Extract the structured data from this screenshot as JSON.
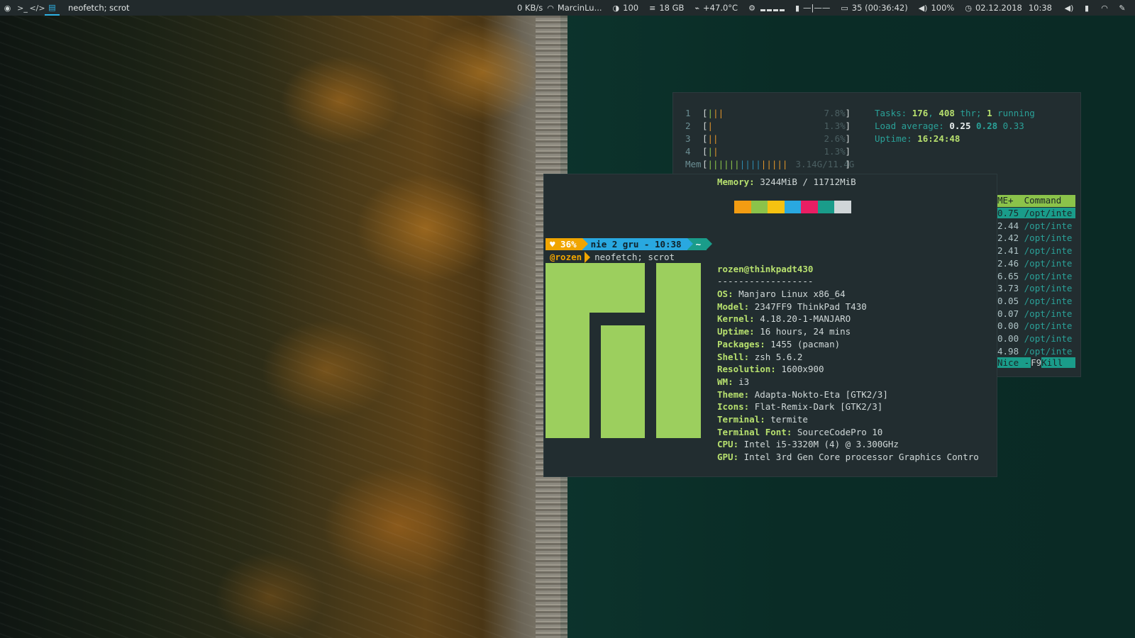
{
  "topbar": {
    "workspaces": [
      {
        "icon": "chrome-icon",
        "glyph": "◉"
      },
      {
        "icon": "terminal-icon",
        "glyph": ">_"
      },
      {
        "icon": "code-icon",
        "glyph": "</>"
      },
      {
        "icon": "document-icon",
        "glyph": "▤"
      }
    ],
    "window_title": "neofetch; scrot",
    "net_speed": "0 KB/s",
    "wifi_name": "MarcinLu...",
    "brightness": "100",
    "disk": "18 GB",
    "temperature": "+47.0°C",
    "cpu_bars": [
      0.25,
      0.25,
      0.25,
      0.25
    ],
    "volume_bar_glyph": "—|——",
    "battery": "35 (00:36:42)",
    "volume": "100%",
    "date": "02.12.2018",
    "time": "10:38",
    "accent": "#2eb3e5"
  },
  "htop": {
    "cpus": [
      {
        "num": "1",
        "bars": [
          {
            "c": "g",
            "n": 1
          },
          {
            "c": "o",
            "n": 2
          }
        ],
        "pct": "7.8%"
      },
      {
        "num": "2",
        "bars": [
          {
            "c": "o",
            "n": 1
          }
        ],
        "pct": "1.3%"
      },
      {
        "num": "3",
        "bars": [
          {
            "c": "o",
            "n": 2
          }
        ],
        "pct": "2.6%"
      },
      {
        "num": "4",
        "bars": [
          {
            "c": "g",
            "n": 1
          },
          {
            "c": "o",
            "n": 1
          }
        ],
        "pct": "1.3%"
      }
    ],
    "mem": {
      "label": "Mem",
      "bars": [
        {
          "c": "g",
          "n": 6
        },
        {
          "c": "b",
          "n": 4
        },
        {
          "c": "o",
          "n": 5
        }
      ],
      "value": "3.14G/11.4G"
    },
    "tasks_label": "Tasks:",
    "tasks": "176",
    "thr": "408",
    "thr_label": "thr;",
    "running": "1",
    "running_label": "running",
    "load_label": "Load average:",
    "load1": "0.25",
    "load5": "0.28",
    "load15": "0.33",
    "uptime_label": "Uptime:",
    "uptime": "16:24:48",
    "proc_header": "ME+  Command",
    "procs": [
      {
        "time": "0.75",
        "cmd": "/opt/inte"
      },
      {
        "time": "2.44",
        "cmd": "/opt/inte"
      },
      {
        "time": "2.42",
        "cmd": "/opt/inte"
      },
      {
        "time": "2.41",
        "cmd": "/opt/inte"
      },
      {
        "time": "2.46",
        "cmd": "/opt/inte"
      },
      {
        "time": "6.65",
        "cmd": "/opt/inte"
      },
      {
        "time": "3.73",
        "cmd": "/opt/inte"
      },
      {
        "time": "0.05",
        "cmd": "/opt/inte"
      },
      {
        "time": "0.07",
        "cmd": "/opt/inte"
      },
      {
        "time": "0.00",
        "cmd": "/opt/inte"
      },
      {
        "time": "0.00",
        "cmd": "/opt/inte"
      },
      {
        "time": "4.98",
        "cmd": "/opt/inte"
      }
    ],
    "footer_nice": "Nice -",
    "footer_key": "F9",
    "footer_kill": "Kill"
  },
  "terminal": {
    "memory_label": "Memory",
    "memory_value": "3244MiB / 11712MiB",
    "palette": [
      "#f39c12",
      "#8bc34a",
      "#f5c211",
      "#29a8e0",
      "#e91e63",
      "#1a9c8a",
      "#d0d6d8"
    ],
    "prompt": {
      "battery": "♥ 36%",
      "date": "nie  2 gru - 10:38",
      "dir": "~",
      "user": "@rozen",
      "command": "neofetch; scrot"
    },
    "info_title": "rozen@thinkpadt430",
    "separator": "------------------",
    "info": [
      {
        "label": "OS",
        "value": "Manjaro Linux x86_64"
      },
      {
        "label": "Model",
        "value": "2347FF9 ThinkPad T430"
      },
      {
        "label": "Kernel",
        "value": "4.18.20-1-MANJARO"
      },
      {
        "label": "Uptime",
        "value": "16 hours, 24 mins"
      },
      {
        "label": "Packages",
        "value": "1455 (pacman)"
      },
      {
        "label": "Shell",
        "value": "zsh 5.6.2"
      },
      {
        "label": "Resolution",
        "value": "1600x900"
      },
      {
        "label": "WM",
        "value": "i3"
      },
      {
        "label": "Theme",
        "value": "Adapta-Nokto-Eta [GTK2/3]"
      },
      {
        "label": "Icons",
        "value": "Flat-Remix-Dark [GTK2/3]"
      },
      {
        "label": "Terminal",
        "value": "termite"
      },
      {
        "label": "Terminal Font",
        "value": "SourceCodePro 10"
      },
      {
        "label": "CPU",
        "value": "Intel i5-3320M (4) @ 3.300GHz"
      },
      {
        "label": "GPU",
        "value": "Intel 3rd Gen Core processor Graphics Contro"
      }
    ]
  }
}
